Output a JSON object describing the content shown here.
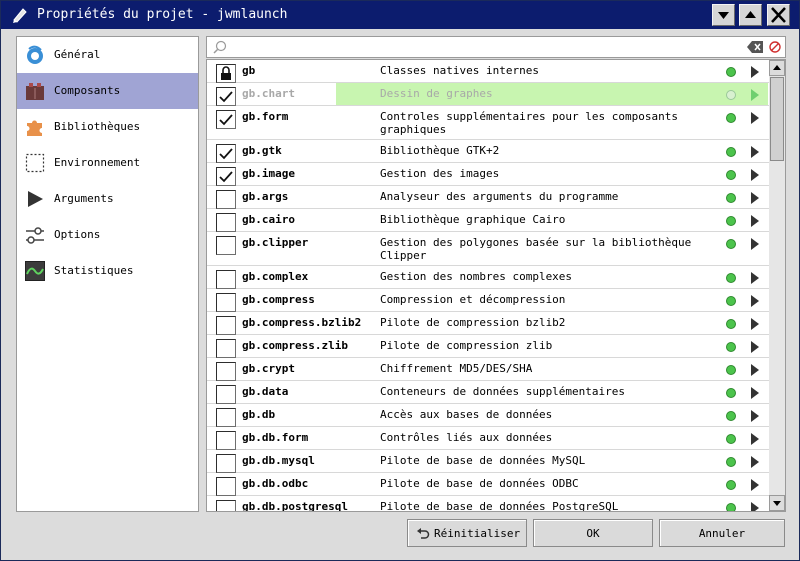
{
  "window": {
    "title": "Propriétés du projet - jwmlaunch",
    "title_bg": "#0c1c6e"
  },
  "sidebar": {
    "items": [
      {
        "label": "Général",
        "icon": "general-icon"
      },
      {
        "label": "Composants",
        "icon": "components-icon",
        "selected": true
      },
      {
        "label": "Bibliothèques",
        "icon": "puzzle-icon"
      },
      {
        "label": "Environnement",
        "icon": "environment-icon"
      },
      {
        "label": "Arguments",
        "icon": "play-arrow-icon"
      },
      {
        "label": "Options",
        "icon": "options-sliders-icon"
      },
      {
        "label": "Statistiques",
        "icon": "statistics-chart-icon"
      }
    ],
    "selected_color": "#a0a4d4"
  },
  "search": {
    "value": "",
    "placeholder": ""
  },
  "components": [
    {
      "name": "gb",
      "description": "Classes natives internes",
      "checked": true,
      "locked": true
    },
    {
      "name": "gb.chart",
      "description": "Dessin de graphes",
      "checked": true,
      "disabled": true,
      "highlighted": true
    },
    {
      "name": "gb.form",
      "description": "Controles supplémentaires pour les composants graphiques",
      "checked": true
    },
    {
      "name": "gb.gtk",
      "description": "Bibliothèque GTK+2",
      "checked": true
    },
    {
      "name": "gb.image",
      "description": "Gestion des images",
      "checked": true
    },
    {
      "name": "gb.args",
      "description": "Analyseur des arguments du programme",
      "checked": false
    },
    {
      "name": "gb.cairo",
      "description": "Bibliothèque graphique Cairo",
      "checked": false
    },
    {
      "name": "gb.clipper",
      "description": "Gestion des polygones basée sur la bibliothèque Clipper",
      "checked": false
    },
    {
      "name": "gb.complex",
      "description": "Gestion des nombres complexes",
      "checked": false
    },
    {
      "name": "gb.compress",
      "description": "Compression et décompression",
      "checked": false
    },
    {
      "name": "gb.compress.bzlib2",
      "description": "Pilote de compression bzlib2",
      "checked": false
    },
    {
      "name": "gb.compress.zlib",
      "description": "Pilote de compression zlib",
      "checked": false
    },
    {
      "name": "gb.crypt",
      "description": "Chiffrement MD5/DES/SHA",
      "checked": false
    },
    {
      "name": "gb.data",
      "description": "Conteneurs de données supplémentaires",
      "checked": false
    },
    {
      "name": "gb.db",
      "description": "Accès aux bases de données",
      "checked": false
    },
    {
      "name": "gb.db.form",
      "description": "Contrôles liés aux données",
      "checked": false
    },
    {
      "name": "gb.db.mysql",
      "description": "Pilote de base de données MySQL",
      "checked": false
    },
    {
      "name": "gb.db.odbc",
      "description": "Pilote de base de données ODBC",
      "checked": false
    },
    {
      "name": "gb.db.postgresql",
      "description": "Pilote de base de données PostgreSQL",
      "checked": false
    }
  ],
  "status_color": "#4cc44c",
  "buttons": {
    "reset": "Réinitialiser",
    "ok": "OK",
    "cancel": "Annuler"
  }
}
